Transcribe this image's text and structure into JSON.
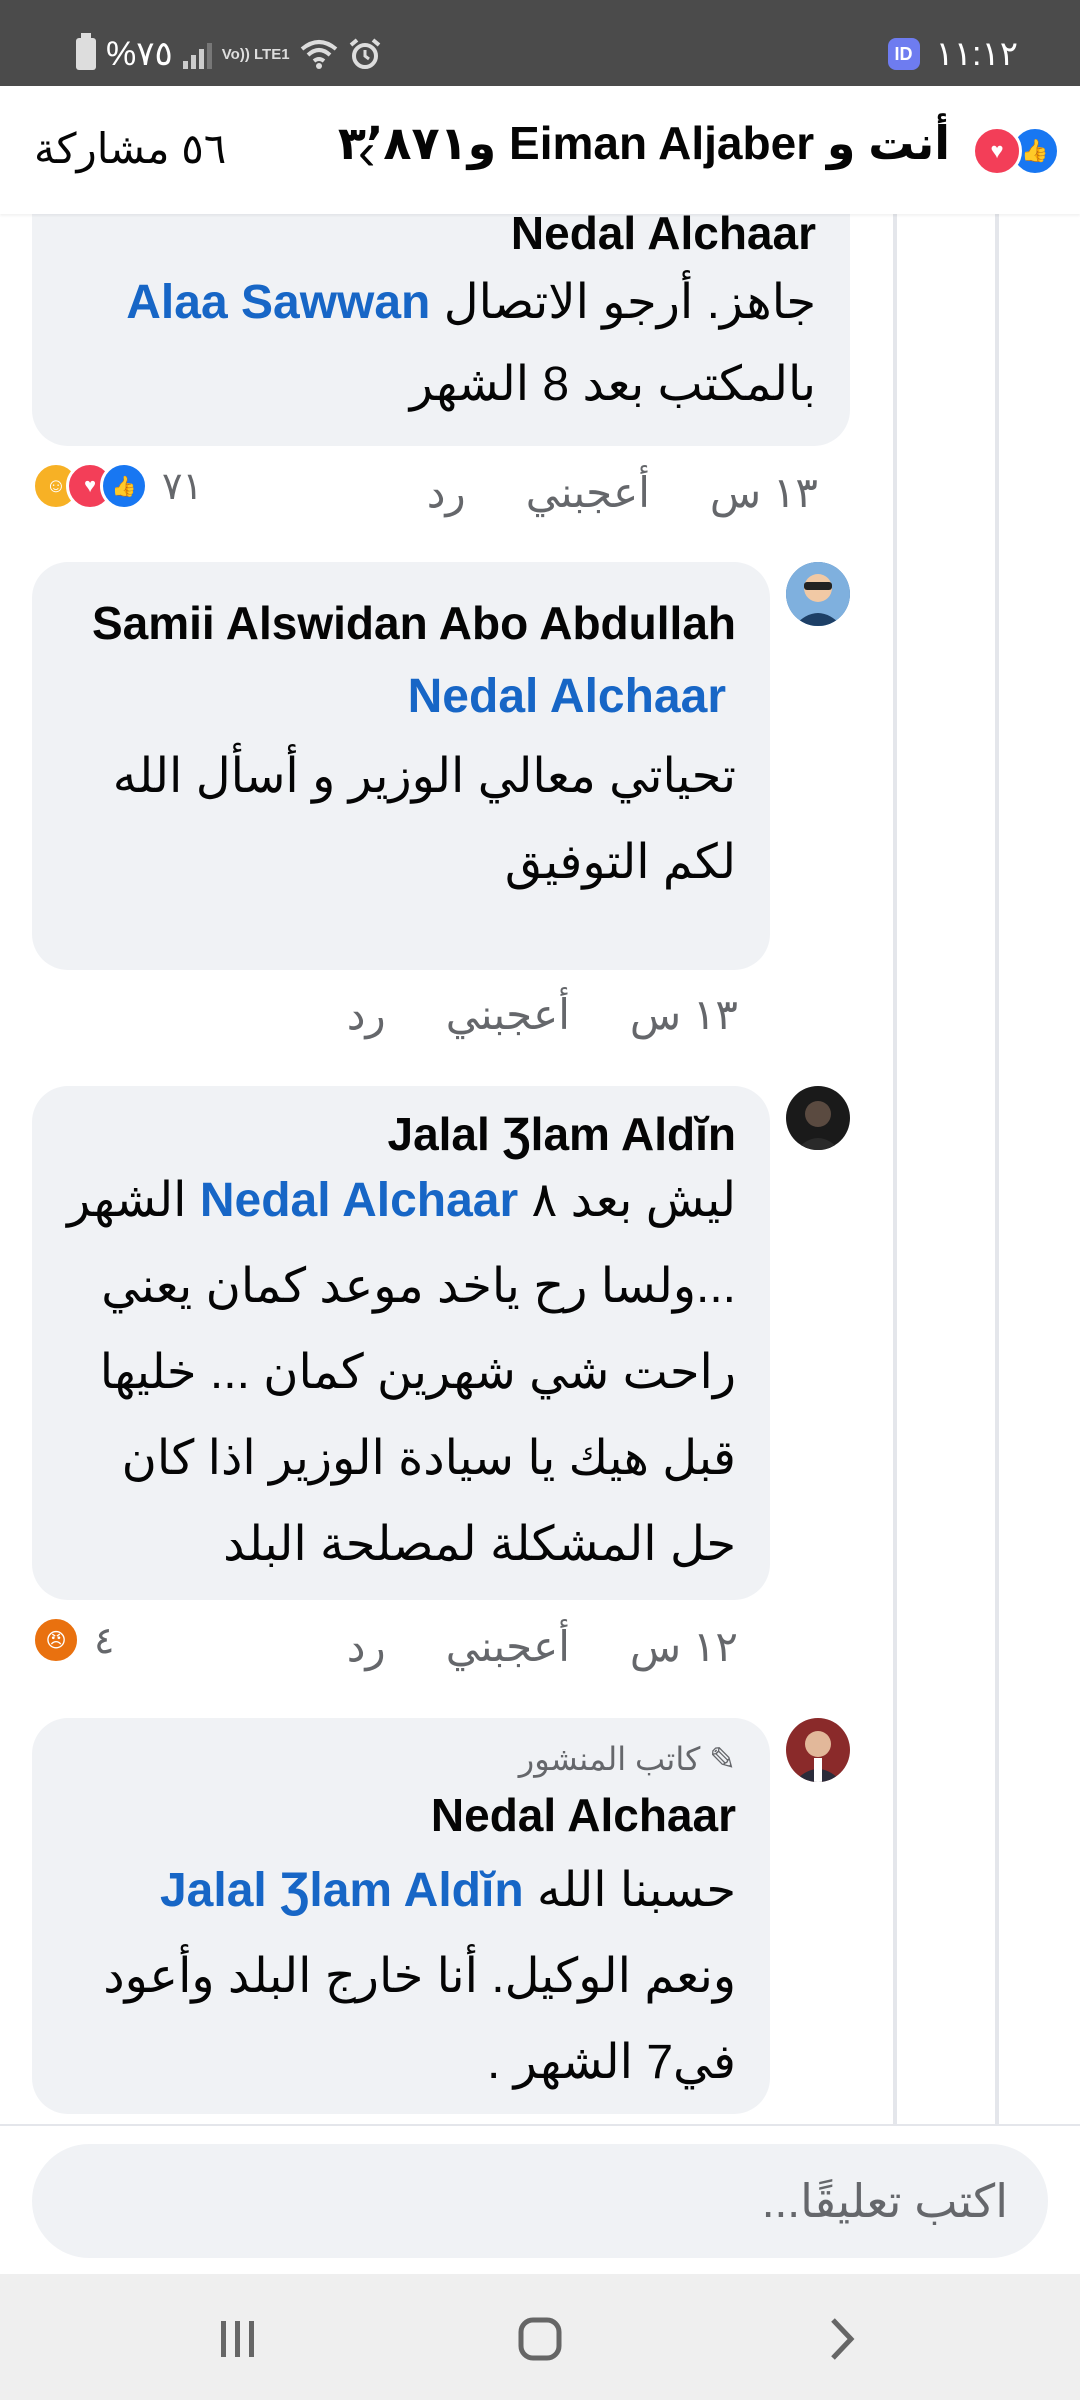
{
  "status_bar": {
    "battery": "%٧٥",
    "network": "Vo)) LTE1",
    "time": "١١:١٢"
  },
  "header": {
    "reaction_text": "أنت و Eiman Aljaber و٣٬٨٧١",
    "shares": "٥٦ مشاركة"
  },
  "comments": [
    {
      "author": "Nedal Alchaar",
      "mention": "Alaa Sawwan",
      "text_before": "جاهز. أرجو الاتصال",
      "text_after": "بالمكتب بعد 8 الشهر",
      "time": "١٣ س",
      "like": "أعجبني",
      "reply": "رد",
      "reaction_count": "٧١"
    },
    {
      "author": "Samii Alswidan Abo Abdullah",
      "mention": "Nedal Alchaar",
      "text": "تحياتي معالي الوزير و أسأل الله لكم التوفيق",
      "time": "١٣ س",
      "like": "أعجبني",
      "reply": "رد"
    },
    {
      "author": "Jalal Ʒlam Aldĭn",
      "mention": "Nedal Alchaar",
      "text_before": "ليش بعد ٨",
      "text_after": "الشهر ...ولسا رح ياخد موعد كمان يعني راحت شي شهرين كمان ... خليها قبل هيك يا سيادة الوزير اذا كان حل المشكلة لمصلحة البلد",
      "time": "١٢ س",
      "like": "أعجبني",
      "reply": "رد",
      "reaction_count": "٤"
    },
    {
      "author_tag": "كاتب المنشور",
      "author": "Nedal Alchaar",
      "mention": "Jalal Ʒlam Aldĭn",
      "text_before": "حسبنا الله",
      "text_after": "ونعم الوكيل. أنا خارج البلد وأعود في7 الشهر ."
    }
  ],
  "comment_box": {
    "placeholder": "اكتب تعليقًا..."
  },
  "colors": {
    "mention": "#1766c6",
    "bubble": "#f0f2f5",
    "like": "#1877f2",
    "love": "#f33e58"
  },
  "icons": [
    "battery-icon",
    "signal-icon",
    "wifi-icon",
    "alarm-icon",
    "like-reaction-icon",
    "love-reaction-icon",
    "care-reaction-icon",
    "angry-reaction-icon",
    "chevron-left-icon",
    "pencil-icon",
    "recents-icon",
    "home-icon",
    "back-icon"
  ]
}
